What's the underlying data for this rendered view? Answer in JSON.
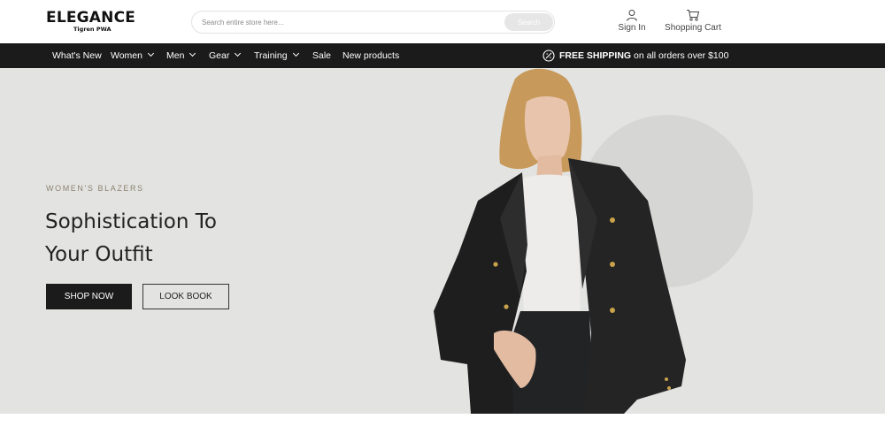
{
  "header": {
    "logo_main": "ELEGANCE",
    "logo_sub": "Tigren PWA",
    "search_placeholder": "Search entire store here...",
    "search_button": "Search",
    "signin_label": "Sign In",
    "cart_label": "Shopping Cart"
  },
  "nav": {
    "items": [
      {
        "label": "What's New"
      },
      {
        "label": "Women"
      },
      {
        "label": "Men"
      },
      {
        "label": "Gear"
      },
      {
        "label": "Training"
      },
      {
        "label": "Sale"
      },
      {
        "label": "New products"
      }
    ],
    "shipping_bold": "FREE SHIPPING",
    "shipping_rest": " on all orders over $100"
  },
  "hero": {
    "eyebrow": "WOMEN'S BLAZERS",
    "headline_line1": "Sophistication To",
    "headline_line2": "Your Outfit",
    "shop_button": "SHOP NOW",
    "look_button": "LOOK BOOK"
  },
  "colors": {
    "navbar": "#1b1b1b",
    "hero_bg": "#e3e4e2",
    "eyebrow": "#8c826f"
  }
}
